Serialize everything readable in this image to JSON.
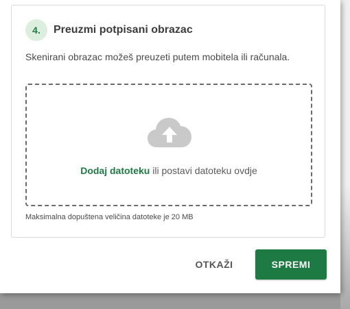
{
  "step": {
    "number": "4.",
    "title": "Preuzmi potpisani obrazac",
    "description": "Skenirani obrazac možeš preuzeti putem mobitela ili računala."
  },
  "upload": {
    "icon": "cloud-upload-icon",
    "link_label": "Dodaj datoteku",
    "rest_label": " ili postavi datoteku ovdje",
    "max_size_note": "Maksimalna dopuštena veličina datoteke je 20 MB"
  },
  "actions": {
    "cancel_label": "OTKAŽI",
    "save_label": "SPREMI"
  },
  "colors": {
    "accent": "#1e7a43",
    "badge_bg": "#dcefdf"
  }
}
